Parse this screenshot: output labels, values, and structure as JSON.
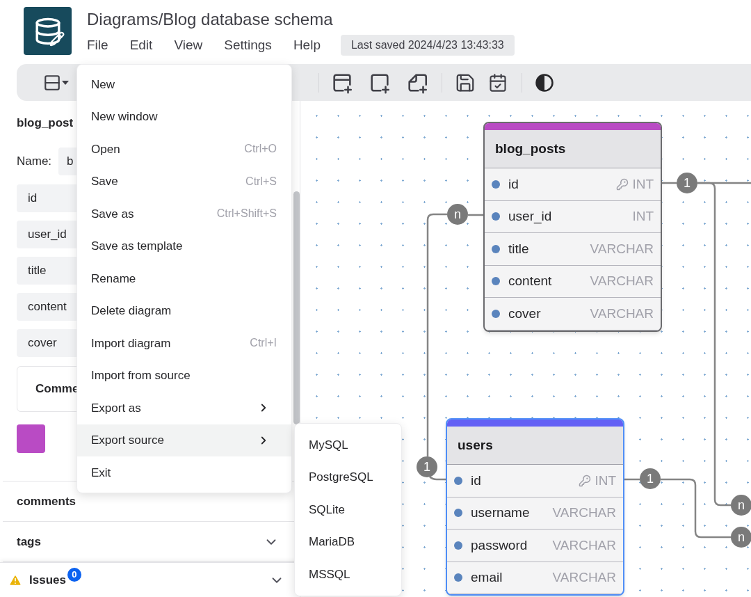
{
  "header": {
    "title": "Diagrams/Blog database schema",
    "menu": [
      "File",
      "Edit",
      "View",
      "Settings",
      "Help"
    ],
    "last_saved": "Last saved 2024/4/23 13:43:33"
  },
  "sidebar": {
    "table_title": "blog_post",
    "name_label": "Name:",
    "name_value": "b",
    "fields": [
      "id",
      "user_id",
      "title",
      "content",
      "cover"
    ],
    "comment_label": "Comme",
    "color": "#b94bc4",
    "other_tables": [
      {
        "name": "comments",
        "chevron": false
      },
      {
        "name": "tags",
        "chevron": true
      }
    ],
    "issues": {
      "label": "Issues",
      "count": "0"
    }
  },
  "file_menu": [
    {
      "label": "New",
      "has_submenu": false,
      "selected": false
    },
    {
      "label": "New window",
      "has_submenu": false,
      "selected": false
    },
    {
      "label": "Open",
      "shortcut": "Ctrl+O",
      "has_submenu": false,
      "selected": false
    },
    {
      "label": "Save",
      "shortcut": "Ctrl+S",
      "has_submenu": false,
      "selected": false
    },
    {
      "label": "Save as",
      "shortcut": "Ctrl+Shift+S",
      "has_submenu": false,
      "selected": false
    },
    {
      "label": "Save as template",
      "has_submenu": false,
      "selected": false
    },
    {
      "label": "Rename",
      "has_submenu": false,
      "selected": false
    },
    {
      "label": "Delete diagram",
      "has_submenu": false,
      "selected": false
    },
    {
      "label": "Import diagram",
      "shortcut": "Ctrl+I",
      "has_submenu": false,
      "selected": false
    },
    {
      "label": "Import from source",
      "has_submenu": false,
      "selected": false
    },
    {
      "label": "Export as",
      "has_submenu": true,
      "selected": false
    },
    {
      "label": "Export source",
      "has_submenu": true,
      "selected": true
    },
    {
      "label": "Exit",
      "has_submenu": false,
      "selected": false
    }
  ],
  "export_submenu": [
    "MySQL",
    "PostgreSQL",
    "SQLite",
    "MariaDB",
    "MSSQL"
  ],
  "canvas": {
    "tables": [
      {
        "name": "blog_posts",
        "color": "#b94bc4",
        "selected": false,
        "fields": [
          {
            "name": "id",
            "type": "INT",
            "primary": true
          },
          {
            "name": "user_id",
            "type": "INT",
            "primary": false
          },
          {
            "name": "title",
            "type": "VARCHAR",
            "primary": false
          },
          {
            "name": "content",
            "type": "VARCHAR",
            "primary": false
          },
          {
            "name": "cover",
            "type": "VARCHAR",
            "primary": false
          }
        ]
      },
      {
        "name": "users",
        "color": "#6360f5",
        "selected": true,
        "fields": [
          {
            "name": "id",
            "type": "INT",
            "primary": true
          },
          {
            "name": "username",
            "type": "VARCHAR",
            "primary": false
          },
          {
            "name": "password",
            "type": "VARCHAR",
            "primary": false
          },
          {
            "name": "email",
            "type": "VARCHAR",
            "primary": false
          }
        ]
      }
    ],
    "relations": [
      {
        "start": "1",
        "end": "n"
      },
      {
        "start": "1",
        "end": "n"
      },
      {
        "start": "1",
        "end": "n"
      }
    ]
  }
}
